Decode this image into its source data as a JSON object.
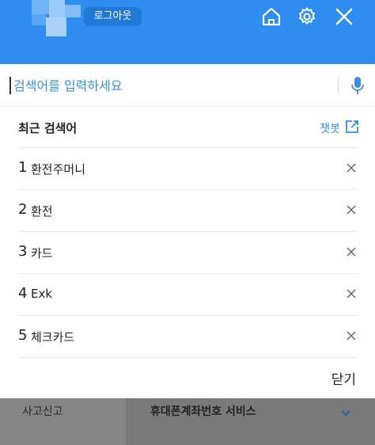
{
  "header": {
    "logout_label": "로그아웃",
    "bg_color": "#2f8df0"
  },
  "search": {
    "placeholder": "검색어를 입력하세요"
  },
  "recent": {
    "title": "최근 검색어",
    "chatbot_label": "챗봇",
    "items": [
      {
        "num": "1",
        "text": "환전주머니"
      },
      {
        "num": "2",
        "text": "환전"
      },
      {
        "num": "3",
        "text": "카드"
      },
      {
        "num": "4",
        "text": "Exk"
      },
      {
        "num": "5",
        "text": "체크카드"
      }
    ],
    "close_label": "닫기"
  },
  "background": {
    "left_label": "사고신고",
    "right_label": "휴대폰계좌번호 서비스"
  }
}
